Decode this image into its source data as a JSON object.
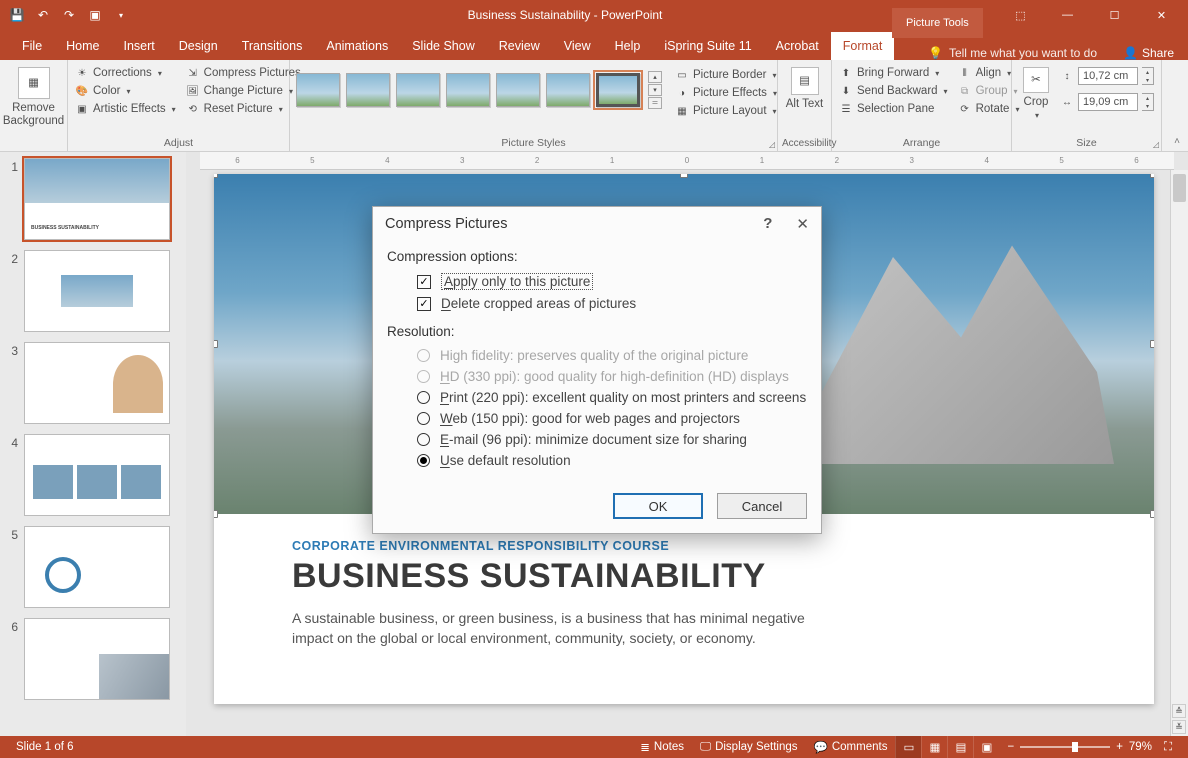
{
  "title": "Business Sustainability  -  PowerPoint",
  "context_tab": "Picture Tools",
  "tabs": {
    "file": "File",
    "home": "Home",
    "insert": "Insert",
    "design": "Design",
    "transitions": "Transitions",
    "animations": "Animations",
    "slideshow": "Slide Show",
    "review": "Review",
    "view": "View",
    "help": "Help",
    "ispring": "iSpring Suite 11",
    "acrobat": "Acrobat",
    "format": "Format"
  },
  "tellme": "Tell me what you want to do",
  "share": "Share",
  "ribbon": {
    "remove_bg": "Remove Background",
    "corrections": "Corrections",
    "color": "Color",
    "artistic": "Artistic Effects",
    "compress": "Compress Pictures",
    "change": "Change Picture",
    "reset": "Reset Picture",
    "group_adjust": "Adjust",
    "group_styles": "Picture Styles",
    "border": "Picture Border",
    "effects": "Picture Effects",
    "layout": "Picture Layout",
    "alt_text": "Alt Text",
    "group_acc": "Accessibility",
    "bring_fwd": "Bring Forward",
    "send_back": "Send Backward",
    "selection": "Selection Pane",
    "align": "Align",
    "group_obj": "Group",
    "rotate": "Rotate",
    "group_arrange": "Arrange",
    "crop": "Crop",
    "height_val": "10,72 cm",
    "width_val": "19,09 cm",
    "group_size": "Size"
  },
  "ruler": [
    "6",
    "5",
    "4",
    "3",
    "2",
    "1",
    "0",
    "1",
    "2",
    "3",
    "4",
    "5",
    "6"
  ],
  "slide": {
    "course": "CORPORATE ENVIRONMENTAL RESPONSIBILITY COURSE",
    "title": "BUSINESS SUSTAINABILITY",
    "body": "A sustainable business, or green business, is a business that has minimal negative impact on the global or local environment, community, society, or economy."
  },
  "thumbs": [
    "1",
    "2",
    "3",
    "4",
    "5",
    "6"
  ],
  "dialog": {
    "title": "Compress Pictures",
    "section1": "Compression options:",
    "opt_apply_pre": "A",
    "opt_apply": "pply only to this picture",
    "opt_delete_pre": "D",
    "opt_delete": "elete cropped areas of pictures",
    "section2": "Resolution:",
    "r_high": "High fidelity: preserves quality of the original picture",
    "r_hd_pre": "H",
    "r_hd": "D (330 ppi): good quality for high-definition (HD) displays",
    "r_print_pre": "P",
    "r_print": "rint (220 ppi): excellent quality on most printers and screens",
    "r_web_pre": "W",
    "r_web": "eb (150 ppi): good for web pages and projectors",
    "r_email_pre": "E",
    "r_email": "-mail (96 ppi): minimize document size for sharing",
    "r_default_pre": "U",
    "r_default": "se default resolution",
    "ok": "OK",
    "cancel": "Cancel"
  },
  "status": {
    "slide": "Slide 1 of 6",
    "notes": "Notes",
    "display": "Display Settings",
    "comments": "Comments",
    "zoom": "79%"
  }
}
